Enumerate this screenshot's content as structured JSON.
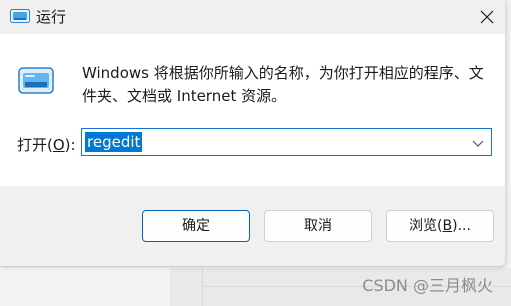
{
  "window": {
    "title": "运行"
  },
  "content": {
    "description_line1": "Windows 将根据你所输入的名称，为你打开相应的程序、文",
    "description_line2": "件夹、文档或 Internet 资源。",
    "open_label_pre": "打开(",
    "open_label_key": "O",
    "open_label_post": "):",
    "input_value": "regedit"
  },
  "buttons": {
    "ok": "确定",
    "cancel": "取消",
    "browse_pre": "浏览(",
    "browse_key": "B",
    "browse_post": ")..."
  },
  "watermark": "CSDN @三月枫火",
  "icons": {
    "title": "run-icon",
    "close": "close-icon",
    "app": "run-icon",
    "dropdown": "chevron-down-icon"
  },
  "colors": {
    "accent": "#0078d4",
    "selection_text": "#ffffff"
  }
}
